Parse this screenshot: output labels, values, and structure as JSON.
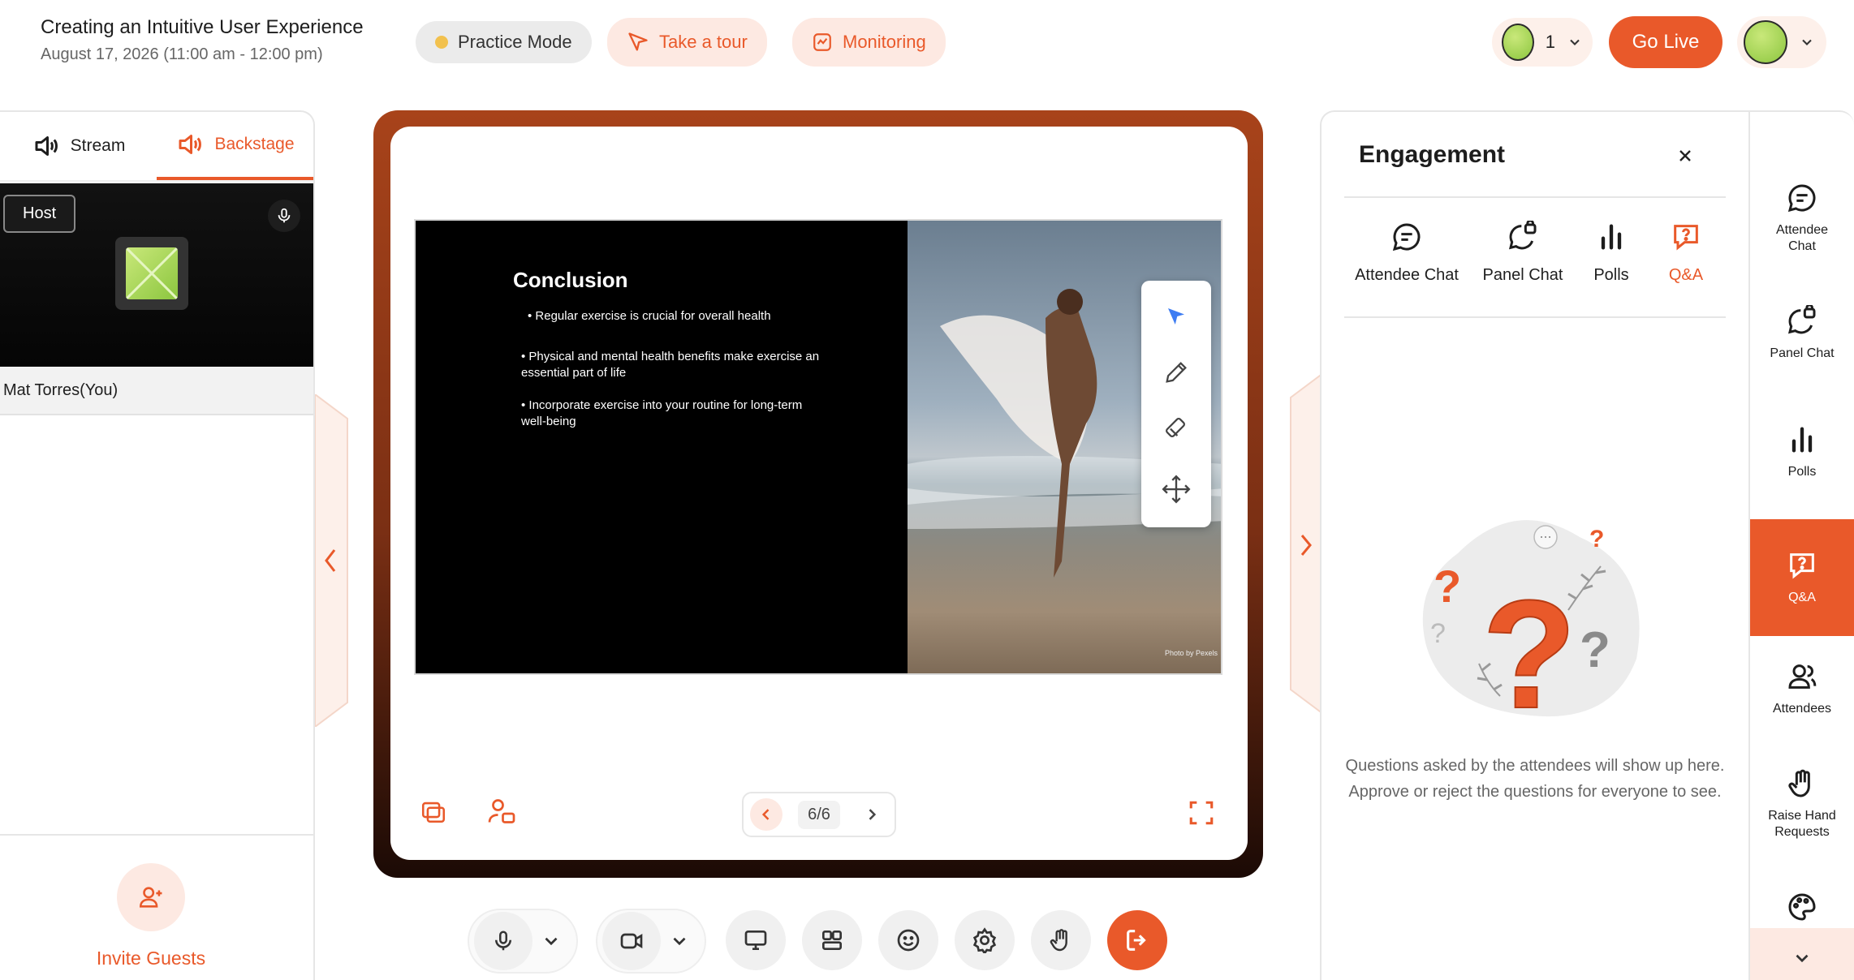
{
  "header": {
    "title": "Creating an Intuitive User Experience",
    "subtitle": "August 17, 2026 (11:00 am - 12:00 pm)",
    "practice_mode": "Practice Mode",
    "take_tour": "Take a tour",
    "monitoring": "Monitoring",
    "attendee_count": "1",
    "go_live": "Go Live"
  },
  "left_panel": {
    "tabs": [
      {
        "label": "Stream"
      },
      {
        "label": "Backstage"
      }
    ],
    "host_label": "Host",
    "host_name": "Mat Torres(You)",
    "invite_label": "Invite Guests"
  },
  "slide": {
    "title": "Conclusion",
    "bullets": [
      "• Regular exercise is crucial for overall health",
      "• Physical and mental health benefits make exercise an essential part of life",
      "• Incorporate exercise into your routine for long-term well-being"
    ],
    "photo_credit": "Photo by Pexels",
    "page": "6/6"
  },
  "engagement": {
    "title": "Engagement",
    "tabs": [
      {
        "label": "Attendee Chat"
      },
      {
        "label": "Panel Chat"
      },
      {
        "label": "Polls"
      },
      {
        "label": "Q&A"
      }
    ],
    "empty_text": "Questions asked by the attendees will show up here. Approve or reject the questions for everyone to see."
  },
  "rail": {
    "items": [
      {
        "label": "Attendee Chat",
        "icon": "chat-bubble-icon"
      },
      {
        "label": "Panel Chat",
        "icon": "panel-chat-icon"
      },
      {
        "label": "Polls",
        "icon": "polls-icon"
      },
      {
        "label": "Q&A",
        "icon": "qa-icon"
      },
      {
        "label": "Attendees",
        "icon": "attendees-icon"
      },
      {
        "label": "Raise Hand Requests",
        "icon": "raise-hand-icon"
      }
    ]
  },
  "colors": {
    "accent": "#e9592a",
    "accent_light": "#fde9e2",
    "practice_dot": "#f2c14e"
  }
}
